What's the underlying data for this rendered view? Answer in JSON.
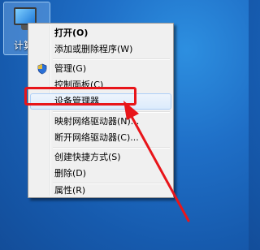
{
  "desktop": {
    "icon_label": "计算机",
    "icon_name": "computer-icon"
  },
  "menu": {
    "items": [
      {
        "label": "打开(O)",
        "bold": true
      },
      {
        "label": "添加或删除程序(W)"
      },
      {
        "label": "管理(G)",
        "icon": "shield-icon"
      },
      {
        "label": "控制面板(C)"
      },
      {
        "label": "设备管理器",
        "highlighted": true
      },
      {
        "label": "映射网络驱动器(N)..."
      },
      {
        "label": "断开网络驱动器(C)..."
      },
      {
        "label": "创建快捷方式(S)"
      },
      {
        "label": "删除(D)"
      },
      {
        "label": "属性(R)"
      }
    ]
  },
  "annotation": {
    "box_color": "#e8151a",
    "arrow_color": "#e8151a"
  }
}
